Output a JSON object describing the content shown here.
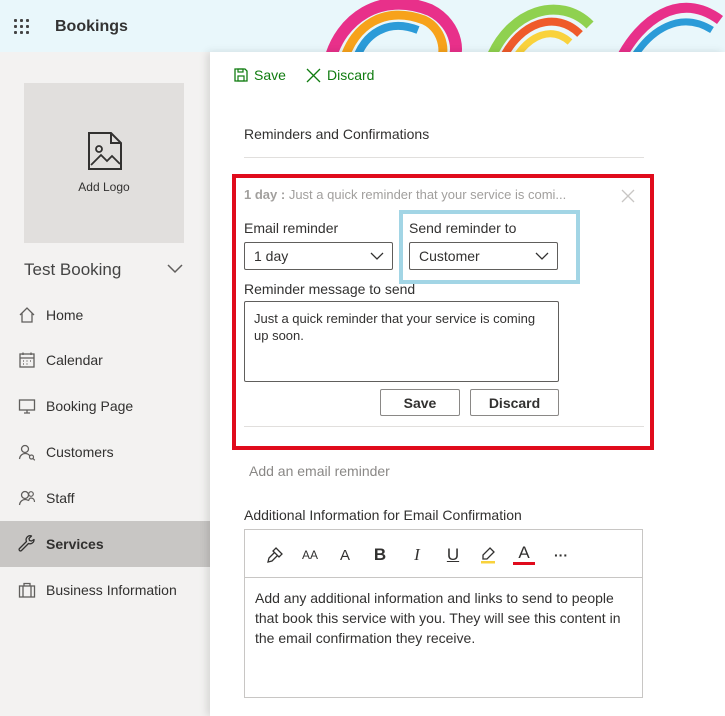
{
  "app": {
    "title": "Bookings"
  },
  "colors": {
    "accent_green": "#107c10",
    "highlight_red": "#e00b1c",
    "highlight_cyan": "#a2d5e5",
    "nav_active": "#c8c6c4"
  },
  "sidebar": {
    "logo_label": "Add Logo",
    "business_name": "Test Booking",
    "items": [
      {
        "label": "Home",
        "icon": "home-icon"
      },
      {
        "label": "Calendar",
        "icon": "calendar-icon"
      },
      {
        "label": "Booking Page",
        "icon": "monitor-icon"
      },
      {
        "label": "Customers",
        "icon": "customers-icon"
      },
      {
        "label": "Staff",
        "icon": "staff-icon"
      },
      {
        "label": "Services",
        "icon": "wrench-icon",
        "active": true
      },
      {
        "label": "Business Information",
        "icon": "briefcase-icon"
      }
    ]
  },
  "toolbar": {
    "save_label": "Save",
    "discard_label": "Discard"
  },
  "reminders": {
    "section_title": "Reminders and Confirmations",
    "summary_bold": "1 day :",
    "summary_text": "Just a quick reminder that your service is comi...",
    "email_reminder_label": "Email reminder",
    "email_reminder_value": "1 day",
    "send_to_label": "Send reminder to",
    "send_to_value": "Customer",
    "message_label": "Reminder message to send",
    "message_value": "Just a quick reminder that your service is coming up soon.",
    "save_label": "Save",
    "discard_label": "Discard",
    "add_link": "Add an email reminder"
  },
  "confirmation": {
    "label": "Additional Information for Email Confirmation",
    "body": "Add any additional information and links to send to people that book this service with you. They will see this content in the email confirmation they receive.",
    "tools": [
      {
        "name": "format-painter-icon"
      },
      {
        "name": "font-size-icon",
        "glyph": "AA"
      },
      {
        "name": "font-grow-icon",
        "glyph": "A"
      },
      {
        "name": "bold-icon",
        "glyph": "B"
      },
      {
        "name": "italic-icon",
        "glyph": "I"
      },
      {
        "name": "underline-icon",
        "glyph": "U"
      },
      {
        "name": "highlighter-icon"
      },
      {
        "name": "font-color-icon",
        "glyph": "A"
      },
      {
        "name": "more-icon",
        "glyph": "···"
      }
    ]
  }
}
